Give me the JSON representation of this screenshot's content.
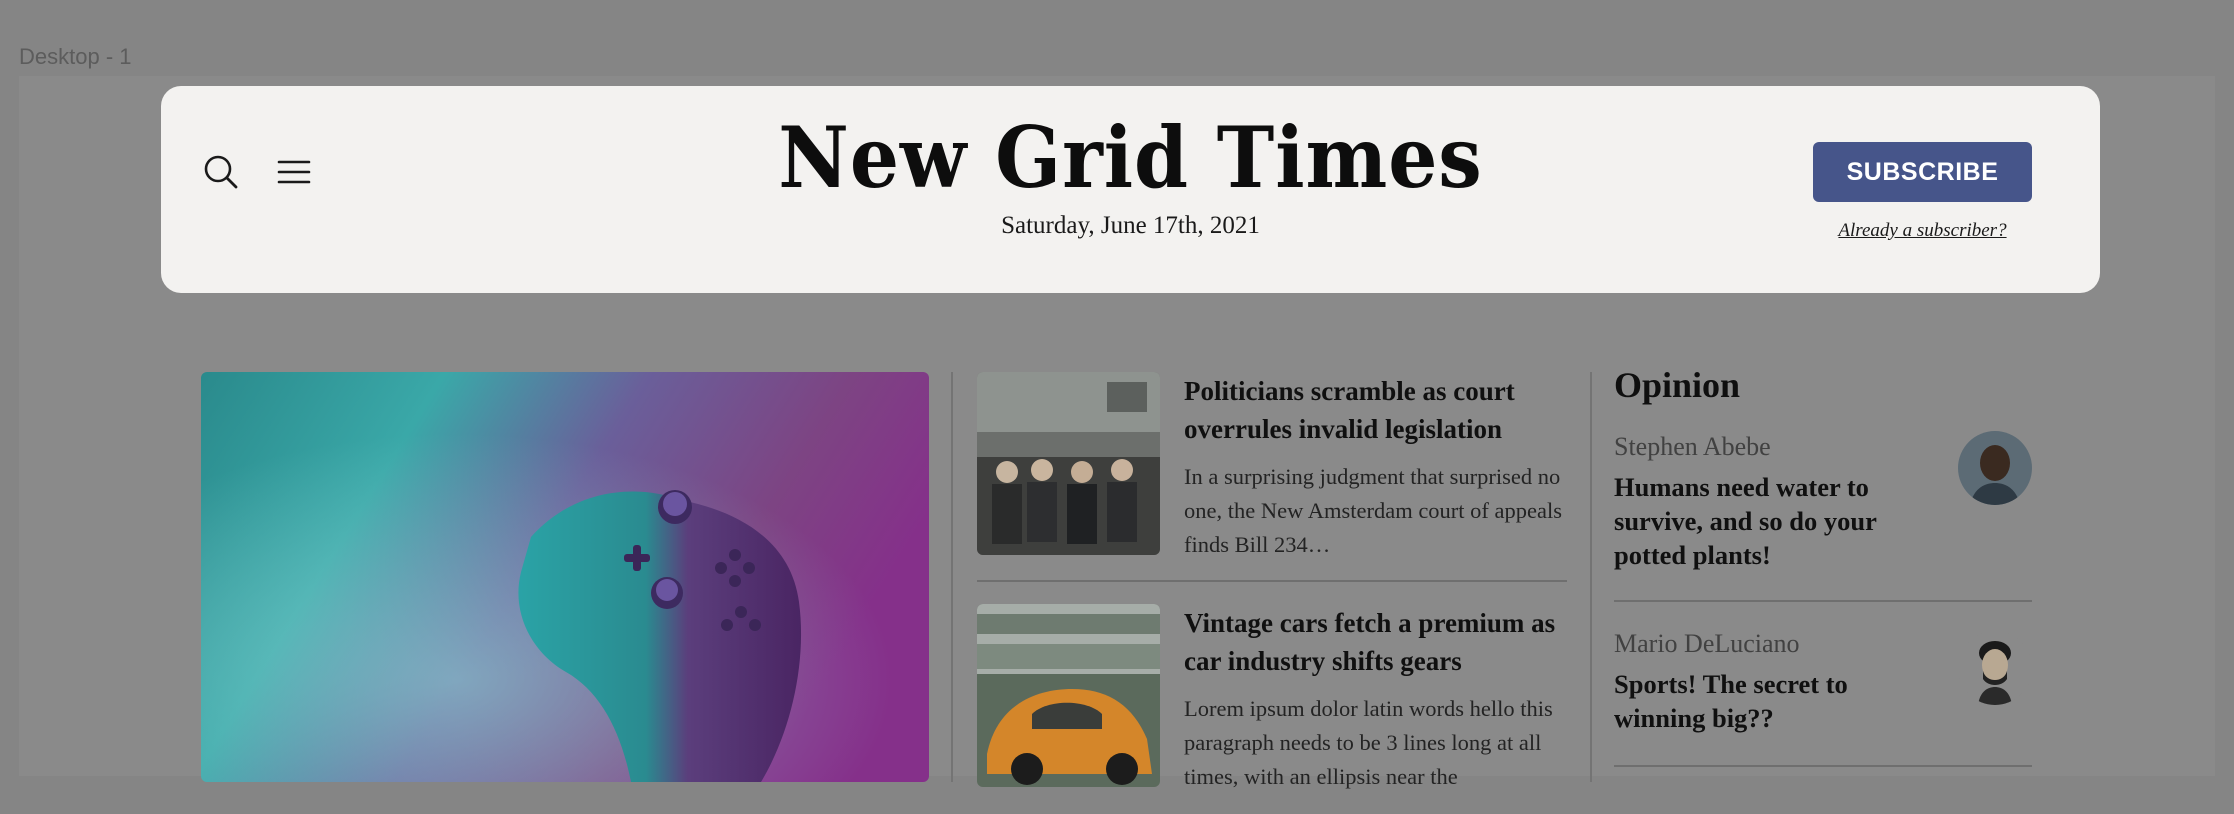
{
  "frame_label": "Desktop - 1",
  "header": {
    "masthead": "New Grid Times",
    "date": "Saturday, June 17th, 2021",
    "subscribe_label": "SUBSCRIBE",
    "already_subscriber": "Already a subscriber?",
    "icons": [
      "search-icon",
      "menu-icon"
    ]
  },
  "stories": [
    {
      "title": "Politicians scramble as court overrules invalid legislation",
      "body": "In a surprising judgment that surprised no one, the New Amsterdam court of appeals finds Bill 234…"
    },
    {
      "title": "Vintage cars fetch a premium as car industry shifts gears",
      "body": "Lorem ipsum dolor latin words hello this paragraph needs to be 3 lines long at all times, with an ellipsis near the"
    }
  ],
  "opinion": {
    "heading": "Opinion",
    "items": [
      {
        "author": "Stephen Abebe",
        "title": "Humans need water to survive, and so do your potted plants!"
      },
      {
        "author": "Mario DeLuciano",
        "title": "Sports! The secret to winning big??"
      }
    ]
  },
  "colors": {
    "overlay_background": "#858585",
    "header_background": "#f3f2f0",
    "subscribe_button": "#46558a"
  }
}
